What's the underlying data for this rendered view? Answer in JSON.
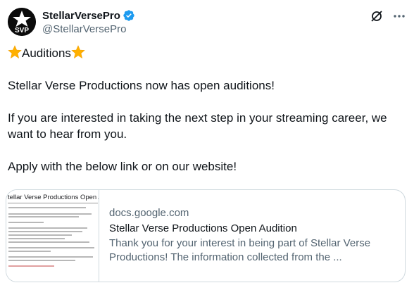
{
  "author": {
    "display_name": "StellarVersePro",
    "handle": "@StellarVersePro",
    "avatar_text": "SVP",
    "verified_color": "#1d9bf0"
  },
  "post": {
    "heading_text": "Auditions",
    "line1": "Stellar Verse Productions now has open auditions!",
    "line2": "If you are interested in taking the next step in your streaming career, we want to hear from you.",
    "line3": "Apply with the below link or on our website!"
  },
  "link_card": {
    "thumbnail_title": "tellar Verse Productions Open Audition",
    "domain": "docs.google.com",
    "title": "Stellar Verse Productions Open Audition",
    "description_line1": "Thank you for your interest in being part of Stellar Verse",
    "description_line2": "Productions! The information collected from the ..."
  },
  "icons": {
    "star": "star-emoji-icon",
    "verified": "verified-badge-icon",
    "grok": "grok-icon",
    "more": "more-options-icon"
  }
}
